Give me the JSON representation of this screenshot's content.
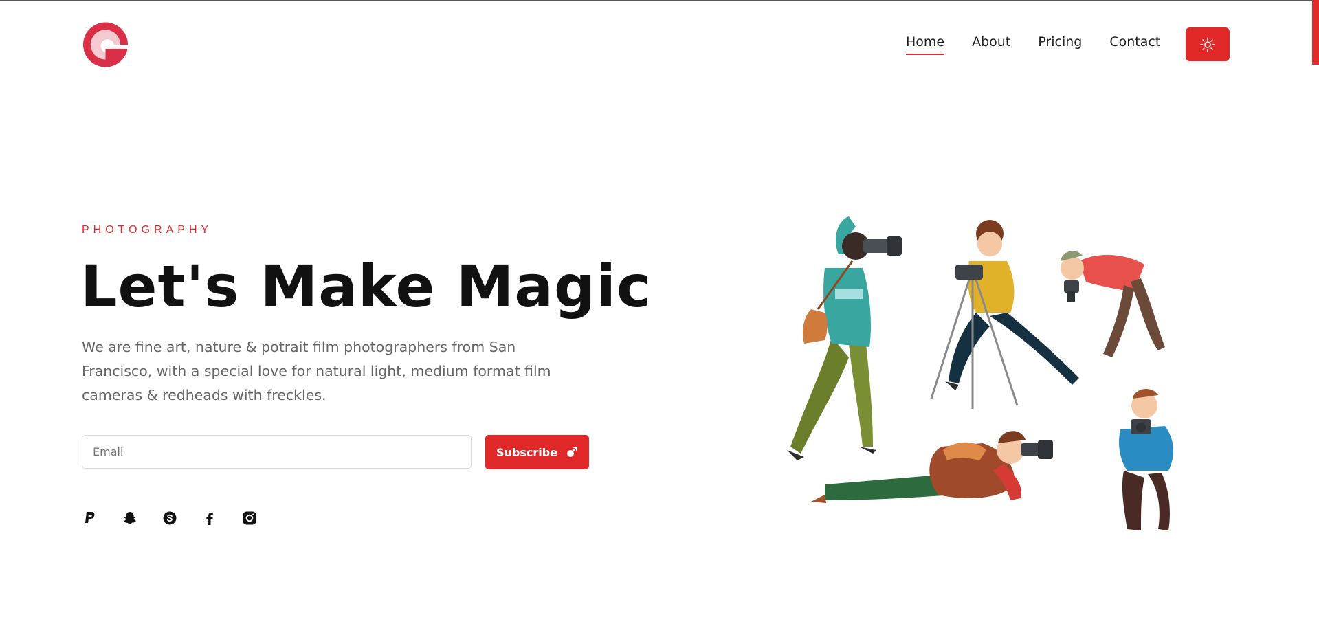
{
  "nav": {
    "items": [
      {
        "label": "Home",
        "active": true
      },
      {
        "label": "About",
        "active": false
      },
      {
        "label": "Pricing",
        "active": false
      },
      {
        "label": "Contact",
        "active": false
      }
    ],
    "theme_toggle_icon": "sun-icon"
  },
  "hero": {
    "eyebrow": "PHOTOGRAPHY",
    "title": "Let's Make Magic",
    "description": "We are fine art, nature & potrait film photographers from San Francisco, with a special love for natural light, medium format film cameras & redheads with freckles.",
    "email_placeholder": "Email",
    "email_value": "",
    "subscribe_label": "Subscribe",
    "subscribe_icon": "rocket-icon"
  },
  "socials": [
    "paypal-icon",
    "snapchat-icon",
    "skype-icon",
    "facebook-icon",
    "instagram-icon"
  ],
  "colors": {
    "accent": "#e02828",
    "text": "#111111",
    "muted": "#666666"
  }
}
